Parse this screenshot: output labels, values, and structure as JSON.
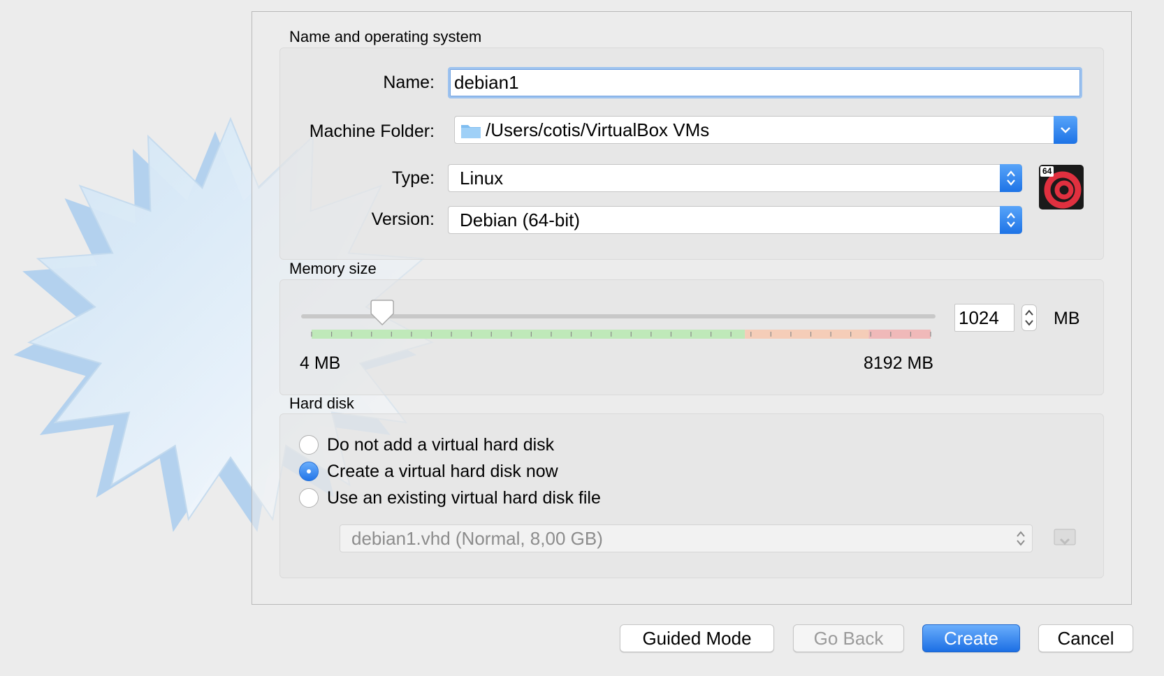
{
  "name_os": {
    "section_title": "Name and operating system",
    "name_label": "Name:",
    "name_value": "debian1",
    "folder_label": "Machine Folder:",
    "folder_value": "/Users/cotis/VirtualBox VMs",
    "type_label": "Type:",
    "type_value": "Linux",
    "version_label": "Version:",
    "version_value": "Debian (64-bit)",
    "os_badge": "64"
  },
  "memory": {
    "section_title": "Memory size",
    "min_label": "4 MB",
    "max_label": "8192 MB",
    "value": "1024",
    "unit": "MB",
    "slider_min": 4,
    "slider_max": 8192,
    "slider_value": 1024
  },
  "hard_disk": {
    "section_title": "Hard disk",
    "options": [
      {
        "label": "Do not add a virtual hard disk",
        "checked": false
      },
      {
        "label": "Create a virtual hard disk now",
        "checked": true
      },
      {
        "label": "Use an existing virtual hard disk file",
        "checked": false
      }
    ],
    "existing_file": "debian1.vhd (Normal, 8,00 GB)"
  },
  "buttons": {
    "guided_mode": "Guided Mode",
    "go_back": "Go Back",
    "create": "Create",
    "cancel": "Cancel"
  },
  "colors": {
    "accent": "#1d73e6",
    "slider_green": "#bfe9b9",
    "slider_orange": "#f5cdb8",
    "slider_red": "#f0b9b9"
  }
}
